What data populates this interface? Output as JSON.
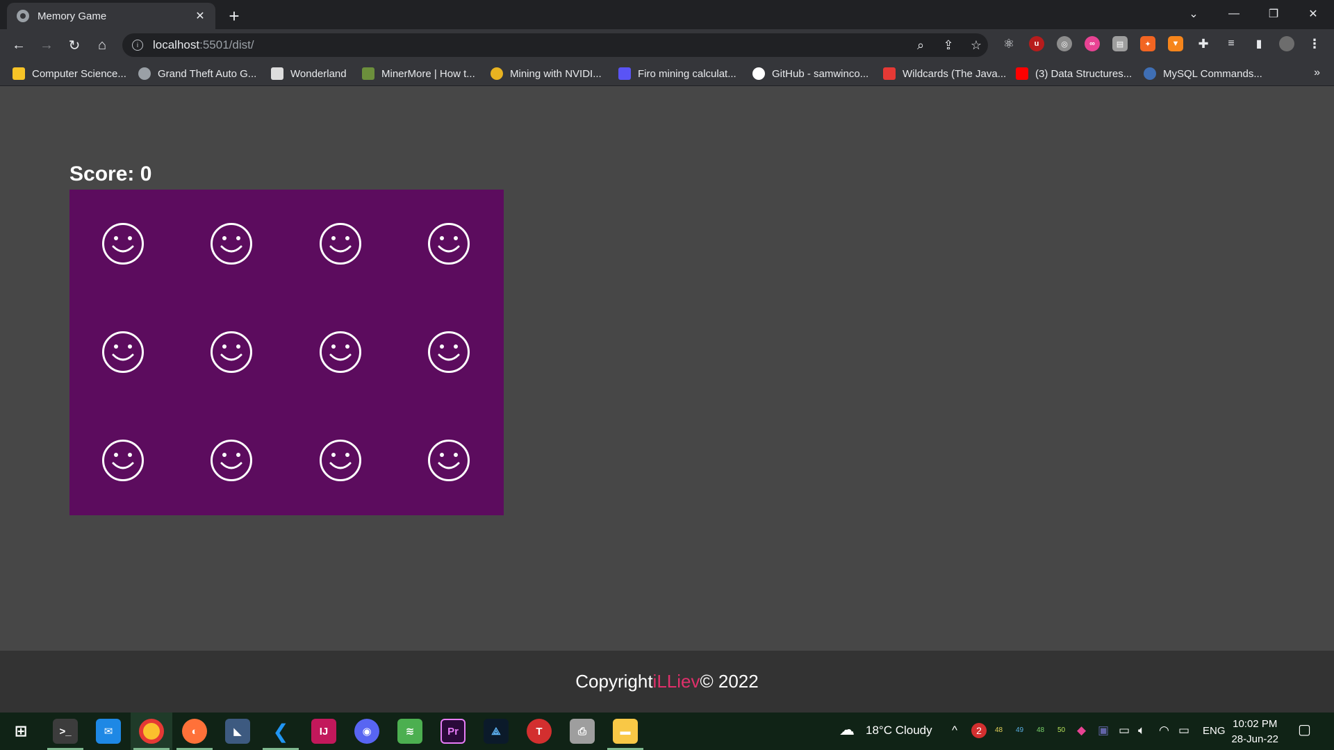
{
  "browser": {
    "tab_title": "Memory Game",
    "close_tab_glyph": "✕",
    "new_tab_glyph": "+",
    "url_host": "localhost",
    "url_path": ":5501/dist/",
    "bookmarks": [
      {
        "label": "Computer Science...",
        "icon": "python-icon",
        "color": "#f7c427"
      },
      {
        "label": "Grand Theft Auto G...",
        "icon": "globe-icon",
        "color": "#9aa0a6"
      },
      {
        "label": "Wonderland",
        "icon": "chart-icon",
        "color": "#dddddd"
      },
      {
        "label": "MinerMore | How t...",
        "icon": "m-logo-icon",
        "color": "#6c8f3c"
      },
      {
        "label": "Mining with NVIDI...",
        "icon": "chrome-icon",
        "color": "#e8b321"
      },
      {
        "label": "Firo mining calculat...",
        "icon": "m-square-icon",
        "color": "#5a54f5"
      },
      {
        "label": "GitHub - samwinco...",
        "icon": "github-icon",
        "color": "#ffffff"
      },
      {
        "label": "Wildcards (The Java...",
        "icon": "oracle-icon",
        "color": "#e53935"
      },
      {
        "label": "(3) Data Structures...",
        "icon": "youtube-icon",
        "color": "#ff0000"
      },
      {
        "label": "MySQL Commands...",
        "icon": "globe-icon",
        "color": "#3f6fb5"
      }
    ],
    "more_bookmarks": "»"
  },
  "page": {
    "score_label": "Score: 0",
    "board": {
      "cols": 4,
      "rows": 3,
      "face_down_icon": "smiley-icon",
      "color": "#5c0c5e"
    },
    "footer": {
      "prefix": "Copyright ",
      "author": "iLLiev",
      "suffix": " © 2022",
      "author_color": "#e0306b"
    }
  },
  "taskbar": {
    "weather": "18°C  Cloudy",
    "language": "ENG",
    "time": "10:02 PM",
    "date": "28-Jun-22",
    "notification_count": "2",
    "tray_numbers": [
      "48",
      "49",
      "48",
      "50"
    ]
  }
}
